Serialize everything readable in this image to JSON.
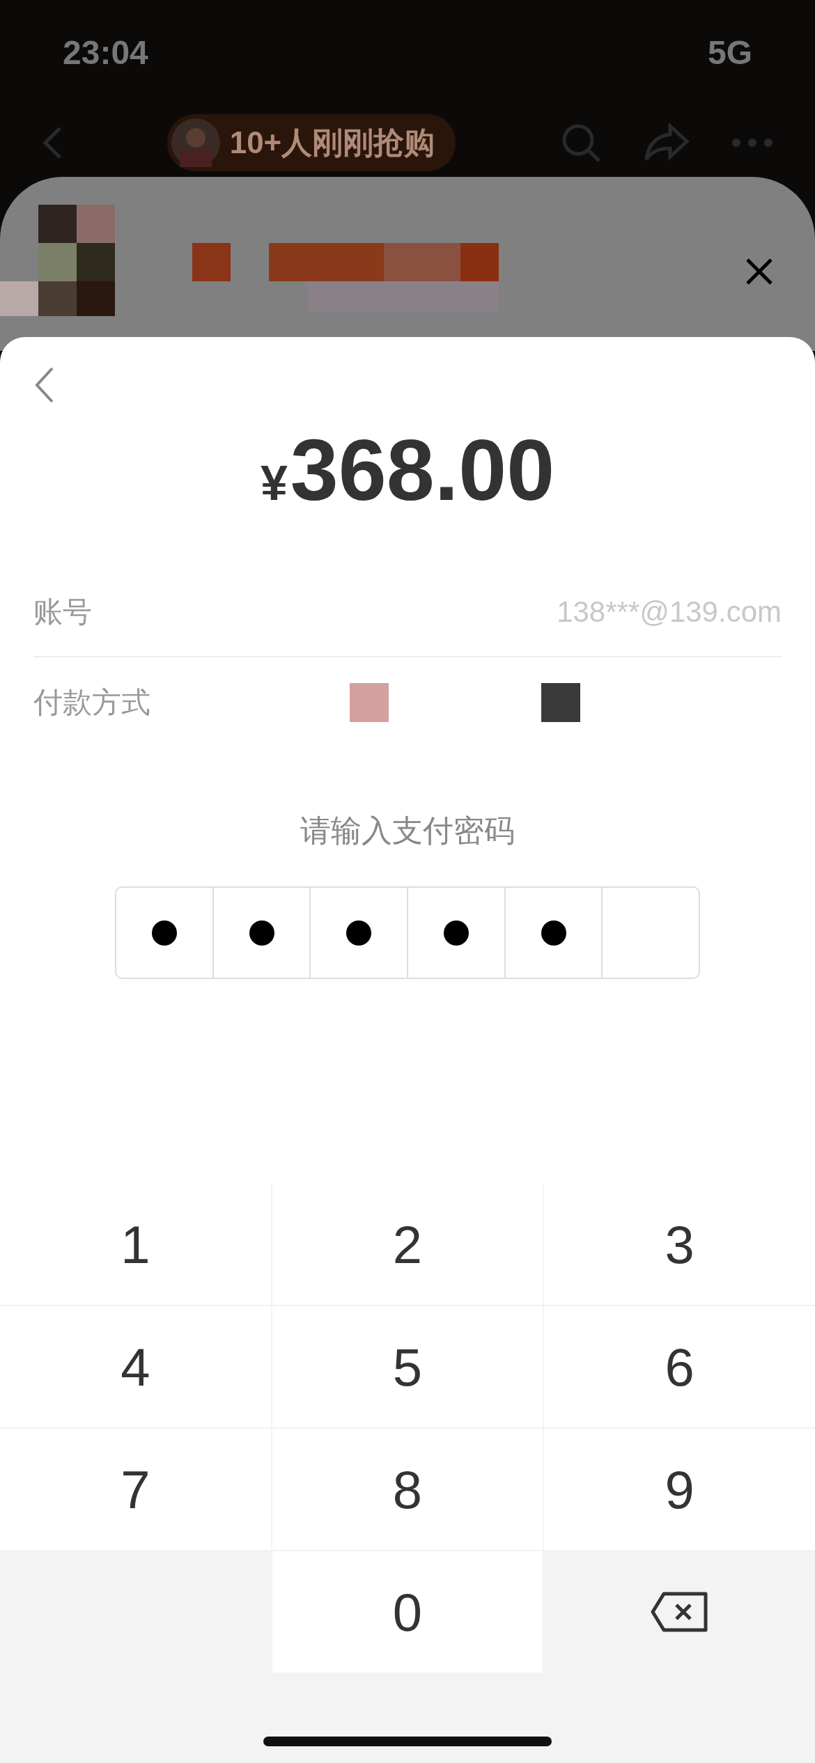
{
  "status_bar": {
    "time": "23:04",
    "network": "5G"
  },
  "nav_bar": {
    "badge": "10+人刚刚抢购"
  },
  "payment": {
    "currency": "¥",
    "amount": "368.00",
    "rows": [
      {
        "kind": "text",
        "label": "账号",
        "value": "138***@139.com"
      },
      {
        "kind": "method",
        "label": "付款方式"
      }
    ],
    "prompt": "请输入支付密码",
    "pin": [
      {
        "filled": true
      },
      {
        "filled": true
      },
      {
        "filled": true
      },
      {
        "filled": true
      },
      {
        "filled": true
      },
      {
        "filled": false
      }
    ]
  },
  "keypad": [
    {
      "kind": "digit",
      "label": "1"
    },
    {
      "kind": "digit",
      "label": "2"
    },
    {
      "kind": "digit",
      "label": "3"
    },
    {
      "kind": "digit",
      "label": "4"
    },
    {
      "kind": "digit",
      "label": "5"
    },
    {
      "kind": "digit",
      "label": "6"
    },
    {
      "kind": "digit",
      "label": "7"
    },
    {
      "kind": "digit",
      "label": "8"
    },
    {
      "kind": "digit",
      "label": "9"
    },
    {
      "kind": "blank"
    },
    {
      "kind": "digit",
      "label": "0"
    },
    {
      "kind": "backspace"
    }
  ]
}
